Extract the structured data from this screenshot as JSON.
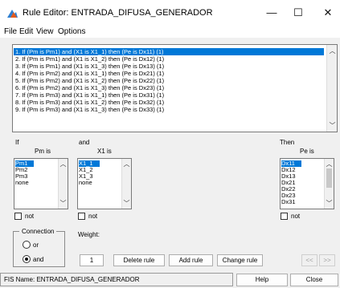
{
  "window": {
    "title": "Rule Editor: ENTRADA_DIFUSA_GENERADOR",
    "minimize_glyph": "—",
    "maximize_glyph": "☐",
    "close_glyph": "✕"
  },
  "menu": [
    "File",
    "Edit",
    "View",
    "Options"
  ],
  "rules": [
    "1. If (Pm is Pm1) and (X1 is X1_1) then (Pe is Dx11) (1)",
    "2. If (Pm is Pm1) and (X1 is X1_2) then (Pe is Dx12) (1)",
    "3. If (Pm is Pm1) and (X1 is X1_3) then (Pe is Dx13) (1)",
    "4. If (Pm is Pm2) and (X1 is X1_1) then (Pe is Dx21) (1)",
    "5. If (Pm is Pm2) and (X1 is X1_2) then (Pe is Dx22) (1)",
    "6. If (Pm is Pm2) and (X1 is X1_3) then (Pe is Dx23) (1)",
    "7. If (Pm is Pm3) and (X1 is X1_1) then (Pe is Dx31) (1)",
    "8. If (Pm is Pm3) and (X1 is X1_2) then (Pe is Dx32) (1)",
    "9. If (Pm is Pm3) and (X1 is X1_3) then (Pe is Dx33) (1)"
  ],
  "if_section": {
    "header": "If",
    "variable_label": "Pm is",
    "options": [
      "Pm1",
      "Pm2",
      "Pm3",
      "none"
    ],
    "not_label": "not"
  },
  "and_section": {
    "header": "and",
    "variable_label": "X1 is",
    "options": [
      "X1_1",
      "X1_2",
      "X1_3",
      "none"
    ],
    "not_label": "not"
  },
  "then_section": {
    "header": "Then",
    "variable_label": "Pe is",
    "options": [
      "Dx11",
      "Dx12",
      "Dx13",
      "Dx21",
      "Dx22",
      "Dx23",
      "Dx31"
    ],
    "not_label": "not"
  },
  "connection": {
    "label": "Connection",
    "or_label": "or",
    "and_label": "and",
    "selected": "and"
  },
  "weight": {
    "label": "Weight:",
    "value": "1"
  },
  "buttons": {
    "delete_rule": "Delete rule",
    "add_rule": "Add rule",
    "change_rule": "Change rule",
    "prev": "<<",
    "next": ">>",
    "help": "Help",
    "close": "Close"
  },
  "status": {
    "fis_name": "FIS Name: ENTRADA_DIFUSA_GENERADOR"
  },
  "colors": {
    "selection": "#0078d7",
    "background": "#f0f0f0"
  },
  "icons": [
    "app-icon",
    "minimize-icon",
    "maximize-icon",
    "close-icon",
    "scroll-up-icon",
    "scroll-down-icon"
  ]
}
